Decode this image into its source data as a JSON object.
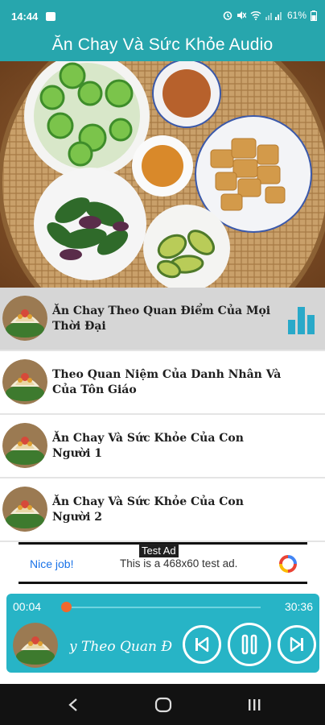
{
  "status_bar": {
    "time": "14:44",
    "battery": "61%"
  },
  "app": {
    "title": "Ăn Chay Và Sức Khỏe Audio"
  },
  "tracks": [
    {
      "title": "Ăn Chay Theo Quan Điểm Của Mọi Thời Đại",
      "active": true
    },
    {
      "title": "Theo Quan Niệm Của Danh Nhân Và Của Tôn Giáo",
      "active": false
    },
    {
      "title": "Ăn Chay Và Sức Khỏe Của Con Người 1",
      "active": false
    },
    {
      "title": "Ăn Chay Và Sức Khỏe Của Con Người 2",
      "active": false
    }
  ],
  "ad": {
    "tag": "Test Ad",
    "nice": "Nice job!",
    "text": "This is a 468x60 test ad."
  },
  "player": {
    "current_time": "00:04",
    "total_time": "30:36",
    "progress": 0.002,
    "now_playing": "y Theo Quan Đ"
  },
  "icons": {
    "prev": "skip-previous-icon",
    "pause": "pause-icon",
    "next": "skip-next-icon",
    "equalizer": "equalizer-icon"
  },
  "colors": {
    "primary": "#27a6ad",
    "player": "#27b4c6",
    "seek_thumb": "#f0682d",
    "active_row": "#d6d6d6"
  }
}
